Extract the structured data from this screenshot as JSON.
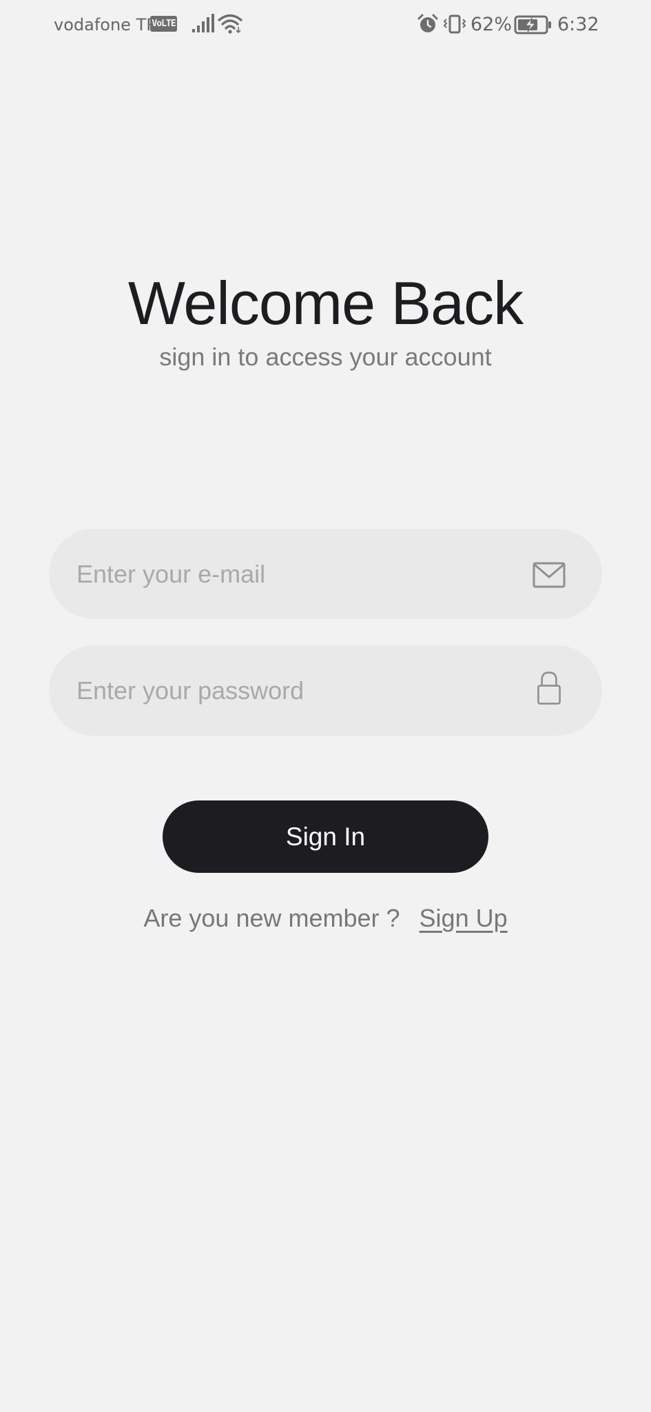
{
  "status_bar": {
    "carrier": "vodafone TR",
    "network_badge": "VoLTE",
    "battery_percent": "62%",
    "time": "6:32",
    "icons": {
      "signal": "signal-bars-icon",
      "wifi": "wifi-icon",
      "alarm": "alarm-clock-icon",
      "vibrate": "vibrate-icon",
      "battery": "battery-charging-icon"
    }
  },
  "header": {
    "title": "Welcome Back",
    "subtitle": "sign in to access your account"
  },
  "form": {
    "email": {
      "value": "",
      "placeholder": "Enter your e-mail",
      "icon": "mail-icon"
    },
    "password": {
      "value": "",
      "placeholder": "Enter your password",
      "icon": "lock-icon"
    },
    "submit_label": "Sign In"
  },
  "footer": {
    "question": "Are you new member ?",
    "signup_label": "Sign Up"
  },
  "colors": {
    "background": "#f2f2f2",
    "primary": "#1d1c21",
    "field_background": "#e9e9e9",
    "muted_text": "#7a7a7a",
    "placeholder": "#a9a9a9"
  }
}
